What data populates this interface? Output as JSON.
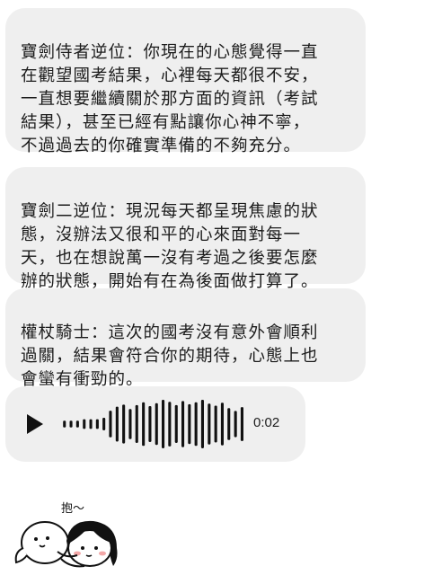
{
  "messages": [
    {
      "text": "寶劍侍者逆位：你現在的心態覺得一直\n在觀望國考結果，心裡每天都很不安，\n一直想要繼續關於那方面的資訊（考試\n結果），甚至已經有點讓你心神不寧，\n不過過去的你確實準備的不夠充分。"
    },
    {
      "text": "寶劍二逆位：現況每天都呈現焦慮的狀\n態，沒辦法又很和平的心來面對每一\n天，也在想說萬一沒有考過之後要怎麼\n辦的狀態，開始有在為後面做打算了。"
    },
    {
      "text": "權杖騎士：這次的國考沒有意外會順利\n過關，結果會符合你的期待，心態上也\n會蠻有衝勁的。"
    }
  ],
  "voice_message": {
    "duration": "0:02",
    "icon": "play-icon",
    "waveform": [
      0.14,
      0.14,
      0.14,
      0.2,
      0.2,
      0.2,
      0.26,
      0.55,
      0.72,
      0.8,
      0.62,
      0.78,
      0.9,
      0.74,
      0.86,
      1.0,
      0.92,
      0.78,
      0.95,
      0.82,
      0.9,
      1.0,
      0.84,
      0.76,
      0.88,
      0.66,
      0.54,
      0.7
    ]
  },
  "sticker": {
    "caption": "抱～",
    "icon": "hug-sticker-icon"
  },
  "colors": {
    "bubble": "#efefef",
    "text": "#1c1c1c",
    "background": "#ffffff"
  }
}
